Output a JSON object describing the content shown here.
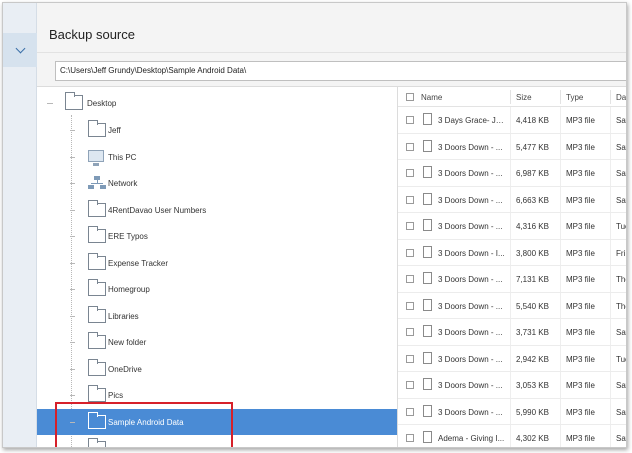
{
  "window": {
    "title": "Backup source"
  },
  "path": {
    "value": "C:\\Users\\Jeff Grundy\\Desktop\\Sample Android Data\\"
  },
  "tree": {
    "root": "Desktop",
    "items": [
      {
        "label": "Jeff",
        "icon": "folder-icon"
      },
      {
        "label": "This PC",
        "icon": "computer-icon"
      },
      {
        "label": "Network",
        "icon": "network-icon"
      },
      {
        "label": "4RentDavao User Numbers",
        "icon": "folder-icon"
      },
      {
        "label": "ERE Typos",
        "icon": "folder-icon"
      },
      {
        "label": "Expense Tracker",
        "icon": "folder-icon"
      },
      {
        "label": "Homegroup",
        "icon": "folder-icon"
      },
      {
        "label": "Libraries",
        "icon": "folder-icon"
      },
      {
        "label": "New folder",
        "icon": "folder-icon"
      },
      {
        "label": "OneDrive",
        "icon": "folder-icon"
      },
      {
        "label": "Pics",
        "icon": "folder-icon"
      },
      {
        "label": "Sample Android Data",
        "icon": "folder-icon",
        "selected": true
      }
    ]
  },
  "files": {
    "columns": {
      "name": "Name",
      "size": "Size",
      "type": "Type",
      "date": "Dat"
    },
    "rows": [
      {
        "name": "3 Days Grace- Ju...",
        "size": "4,418 KB",
        "type": "MP3 file",
        "date": "Sat"
      },
      {
        "name": "3 Doors Down - ...",
        "size": "5,477 KB",
        "type": "MP3 file",
        "date": "Sat"
      },
      {
        "name": "3 Doors Down - ...",
        "size": "6,987 KB",
        "type": "MP3 file",
        "date": "Sat"
      },
      {
        "name": "3 Doors Down - ...",
        "size": "6,663 KB",
        "type": "MP3 file",
        "date": "Sat"
      },
      {
        "name": "3 Doors Down - ...",
        "size": "4,316 KB",
        "type": "MP3 file",
        "date": "Tue"
      },
      {
        "name": "3 Doors Down - I...",
        "size": "3,800 KB",
        "type": "MP3 file",
        "date": "Fri"
      },
      {
        "name": "3 Doors Down - ...",
        "size": "7,131 KB",
        "type": "MP3 file",
        "date": "The"
      },
      {
        "name": "3 Doors Down - ...",
        "size": "5,540 KB",
        "type": "MP3 file",
        "date": "The"
      },
      {
        "name": "3 Doors Down - ...",
        "size": "3,731 KB",
        "type": "MP3 file",
        "date": "Sat"
      },
      {
        "name": "3 Doors Down - ...",
        "size": "2,942 KB",
        "type": "MP3 file",
        "date": "Tue"
      },
      {
        "name": "3 Doors Down - ...",
        "size": "3,053 KB",
        "type": "MP3 file",
        "date": "Sat"
      },
      {
        "name": "3 Doors Down - ...",
        "size": "5,990 KB",
        "type": "MP3 file",
        "date": "Sat"
      },
      {
        "name": "Adema - Giving I...",
        "size": "4,302 KB",
        "type": "MP3 file",
        "date": "Sat"
      }
    ]
  },
  "colors": {
    "accent": "#4a8bd5",
    "highlight": "#d6202a"
  }
}
